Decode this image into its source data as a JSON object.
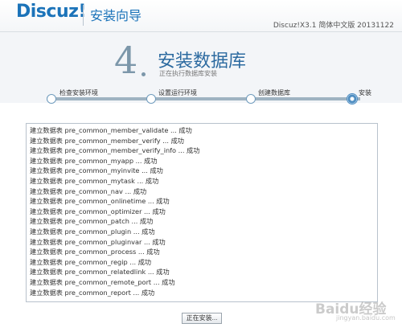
{
  "header": {
    "logo_text": "Discuz!",
    "title": "安装向导",
    "version": "Discuz!X3.1 简体中文版 20131122"
  },
  "step": {
    "number": "4",
    "title": "安装数据库",
    "subtitle": "正在执行数据库安装"
  },
  "progress": {
    "steps": [
      {
        "label": "检查安装环境"
      },
      {
        "label": "设置运行环境"
      },
      {
        "label": "创建数据库"
      },
      {
        "label": "安装"
      }
    ],
    "current_step": 4
  },
  "log": {
    "lines": [
      "建立数据表 pre_common_member_validate ... 成功",
      "建立数据表 pre_common_member_verify ... 成功",
      "建立数据表 pre_common_member_verify_info ... 成功",
      "建立数据表 pre_common_myapp ... 成功",
      "建立数据表 pre_common_myinvite ... 成功",
      "建立数据表 pre_common_mytask ... 成功",
      "建立数据表 pre_common_nav ... 成功",
      "建立数据表 pre_common_onlinetime ... 成功",
      "建立数据表 pre_common_optimizer ... 成功",
      "建立数据表 pre_common_patch ... 成功",
      "建立数据表 pre_common_plugin ... 成功",
      "建立数据表 pre_common_pluginvar ... 成功",
      "建立数据表 pre_common_process ... 成功",
      "建立数据表 pre_common_regip ... 成功",
      "建立数据表 pre_common_relatedlink ... 成功",
      "建立数据表 pre_common_remote_port ... 成功",
      "建立数据表 pre_common_report ... 成功"
    ]
  },
  "button": {
    "label": "正在安装..."
  },
  "watermark": {
    "text": "Baidu经验",
    "sub": "jingyan.baidu.com"
  }
}
